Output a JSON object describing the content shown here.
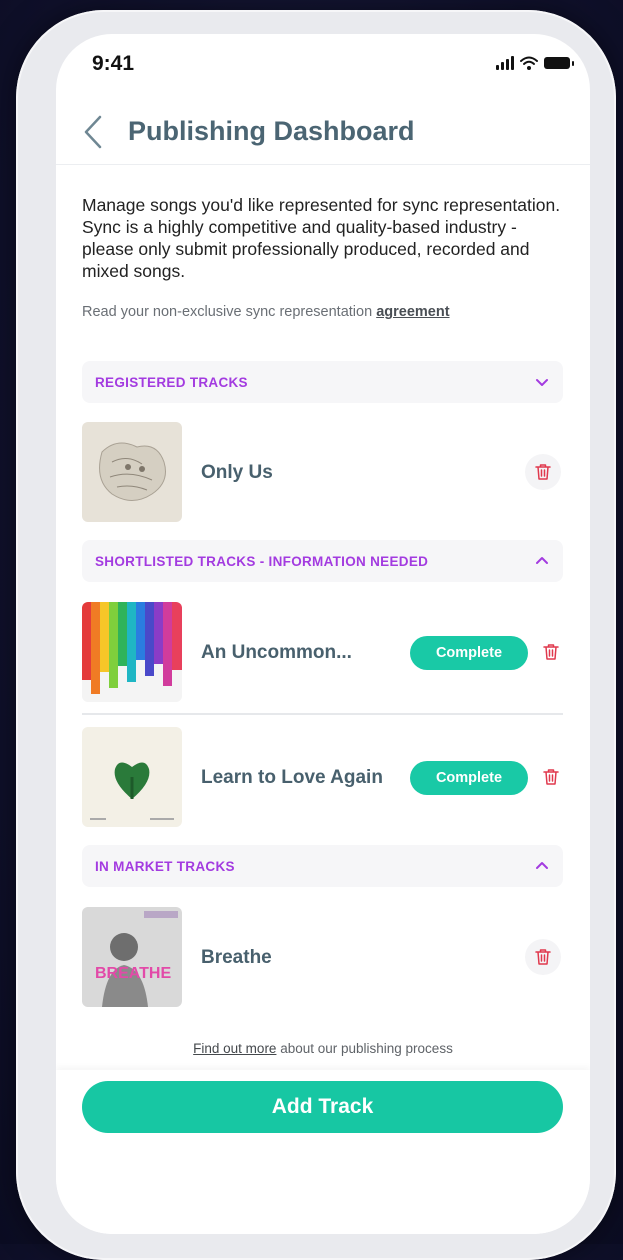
{
  "status_bar": {
    "time": "9:41",
    "icons": [
      "signal-icon",
      "wifi-icon",
      "battery-icon"
    ]
  },
  "header": {
    "back_icon": "chevron-left-icon",
    "title": "Publishing Dashboard"
  },
  "intro": {
    "description": "Manage songs you'd like represented for sync representation. Sync is a highly competitive and quality-based industry - please only submit professionally produced, recorded and mixed songs.",
    "agreement_prefix": "Read your non-exclusive sync representation ",
    "agreement_link": "agreement"
  },
  "sections": [
    {
      "title": "REGISTERED TRACKS",
      "chevron": "chevron-down-icon",
      "tracks": [
        {
          "title": "Only Us",
          "art": "sketch-cat-art",
          "action": null
        }
      ]
    },
    {
      "title": "SHORTLISTED TRACKS - INFORMATION NEEDED",
      "chevron": "chevron-up-icon",
      "tracks": [
        {
          "title": "An Uncommon...",
          "art": "rainbow-drip-art",
          "action": "Complete"
        },
        {
          "title": "Learn to Love Again",
          "art": "green-heart-art",
          "action": "Complete"
        }
      ]
    },
    {
      "title": "IN MARKET TRACKS",
      "chevron": "chevron-up-icon",
      "tracks": [
        {
          "title": "Breathe",
          "art": "child-photo-art",
          "art_text": "BREATHE",
          "action": null
        }
      ]
    }
  ],
  "footer": {
    "link": "Find out more",
    "suffix": " about our publishing process"
  },
  "add_track_label": "Add Track",
  "colors": {
    "accent_purple": "#a33be0",
    "accent_green": "#19c9a6",
    "title_slate": "#4b6573",
    "trash_red": "#e0384d"
  }
}
